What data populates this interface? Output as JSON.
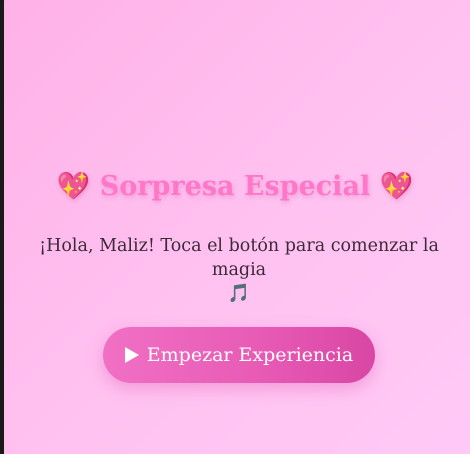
{
  "page": {
    "title": "💖 Sorpresa Especial 💖",
    "subtitle": "¡Hola, Maliz! Toca el botón para comenzar la magia",
    "note_icon": "🎵"
  },
  "actions": {
    "start_button_label": "Empezar Experiencia",
    "start_button_icon": "play-icon"
  },
  "colors": {
    "title": "#ff77c8",
    "button": "#e85cb6",
    "background": "#ffc2f1"
  }
}
